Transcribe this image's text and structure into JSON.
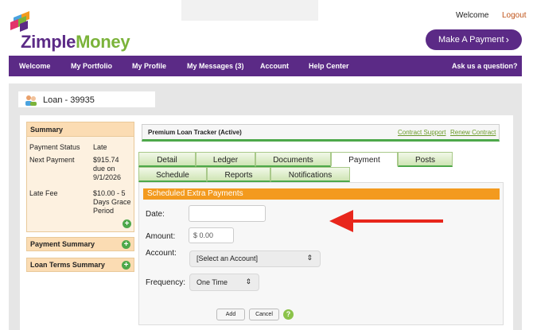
{
  "brand": {
    "logo_z": "Zimple",
    "logo_m": "Money"
  },
  "header": {
    "welcome": "Welcome",
    "logout": "Logout",
    "make_payment": "Make A Payment"
  },
  "nav": [
    "Welcome",
    "My Portfolio",
    "My Profile",
    "My Messages (3)",
    "Account",
    "Help Center",
    "Ask us a question?"
  ],
  "loan": {
    "title": "Loan - 39935"
  },
  "summary": {
    "heading": "Summary",
    "rows": [
      {
        "label": "Payment Status",
        "value": "Late"
      },
      {
        "label": "Next Payment",
        "value": "$915.74 due on 9/1/2026"
      },
      {
        "label": "Late Fee",
        "value": "$10.00 - 5 Days Grace Period"
      }
    ],
    "payment_summary": "Payment Summary",
    "loan_terms_summary": "Loan Terms Summary"
  },
  "tracker": {
    "title": "Premium Loan Tracker (Active)",
    "contract_support": "Contract Support",
    "renew_contract": "Renew Contract"
  },
  "tabs_row1": [
    "Detail",
    "Ledger",
    "Documents",
    "Payment",
    "Posts"
  ],
  "tabs_row2": [
    "Schedule",
    "Reports",
    "Notifications"
  ],
  "active_tab": "Payment",
  "form": {
    "section_title": "Scheduled Extra Payments",
    "date_label": "Date:",
    "date_value": "",
    "amount_label": "Amount:",
    "amount_value": "$ 0.00",
    "account_label": "Account:",
    "account_value": "[Select an Account]",
    "frequency_label": "Frequency:",
    "frequency_value": "One Time",
    "add": "Add",
    "cancel": "Cancel",
    "help": "?"
  },
  "colors": {
    "brand_purple": "#5b2a86",
    "brand_green": "#7bb33a",
    "accent_orange": "#f39a1e",
    "logout": "#c0541a"
  },
  "icons": {
    "plus": "plus-circle-icon",
    "help": "question-circle-icon",
    "chevron": "chevron-right-icon",
    "arrow": "red-arrow-icon"
  }
}
